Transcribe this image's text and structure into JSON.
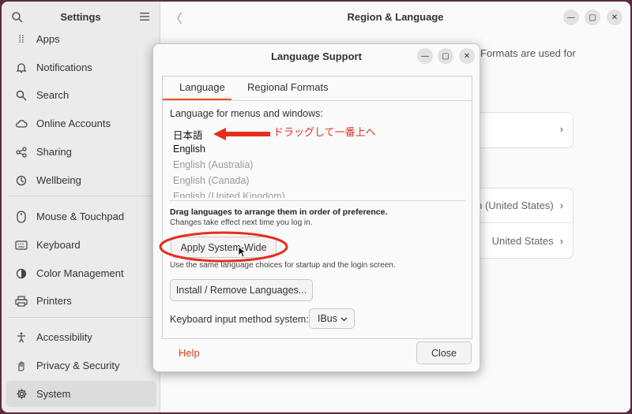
{
  "settings": {
    "title": "Settings",
    "items": [
      {
        "label": "Apps",
        "icon": "apps-icon"
      },
      {
        "label": "Notifications",
        "icon": "bell-icon"
      },
      {
        "label": "Search",
        "icon": "search-icon"
      },
      {
        "label": "Online Accounts",
        "icon": "cloud-icon"
      },
      {
        "label": "Sharing",
        "icon": "share-icon"
      },
      {
        "label": "Wellbeing",
        "icon": "wellbeing-icon"
      },
      {
        "label": "Mouse & Touchpad",
        "icon": "mouse-icon"
      },
      {
        "label": "Keyboard",
        "icon": "keyboard-icon"
      },
      {
        "label": "Color Management",
        "icon": "color-icon"
      },
      {
        "label": "Printers",
        "icon": "printer-icon"
      },
      {
        "label": "Accessibility",
        "icon": "accessibility-icon"
      },
      {
        "label": "Privacy & Security",
        "icon": "hand-icon"
      },
      {
        "label": "System",
        "icon": "gear-icon"
      }
    ],
    "active": "System"
  },
  "main": {
    "title": "Region & Language",
    "formats_text": "Formats are used for",
    "rows": [
      {
        "value": ""
      },
      {
        "value": "h (United States)"
      },
      {
        "value": "United States"
      }
    ]
  },
  "dialog": {
    "title": "Language Support",
    "tabs": [
      "Language",
      "Regional Formats"
    ],
    "menus_label": "Language for menus and windows:",
    "languages": [
      {
        "label": "日本語",
        "enabled": true
      },
      {
        "label": "English",
        "enabled": true
      },
      {
        "label": "English (Australia)",
        "enabled": false
      },
      {
        "label": "English (Canada)",
        "enabled": false
      },
      {
        "label": "English (United Kingdom)",
        "enabled": false
      }
    ],
    "drag_note": "Drag languages to arrange them in order of preference.",
    "login_note": "Changes take effect next time you log in.",
    "apply_button": "Apply System-Wide",
    "startup_note": "Use the same language choices for startup and the login screen.",
    "install_button": "Install / Remove Languages...",
    "input_label": "Keyboard input method system:",
    "input_value": "IBus",
    "help": "Help",
    "close": "Close"
  },
  "annotation": {
    "text": "ドラッグして一番上へ",
    "color": "#e42f1d"
  },
  "colors": {
    "accent": "#e95420",
    "help": "#d4421a"
  }
}
